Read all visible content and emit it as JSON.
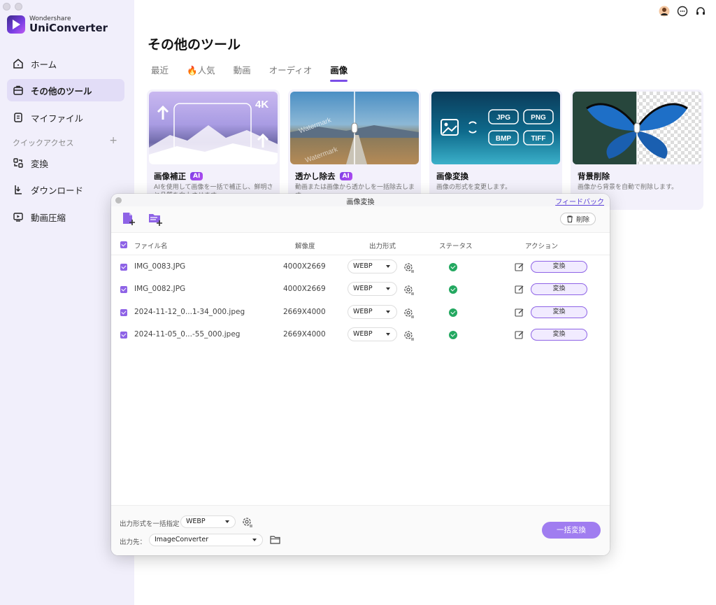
{
  "app": {
    "brand_small": "Wondershare",
    "brand_name": "UniConverter"
  },
  "sidebar": {
    "items": [
      {
        "label": "ホーム",
        "icon": "home-icon"
      },
      {
        "label": "その他のツール",
        "icon": "toolbox-icon",
        "active": true
      },
      {
        "label": "マイファイル",
        "icon": "file-icon"
      }
    ],
    "quick_access_label": "クイックアクセス",
    "quick_access_add": "+",
    "quick_items": [
      {
        "label": "変換",
        "icon": "convert-icon"
      },
      {
        "label": "ダウンロード",
        "icon": "download-icon"
      },
      {
        "label": "動画圧縮",
        "icon": "compress-icon"
      }
    ]
  },
  "header_icons": [
    "account-icon",
    "message-icon",
    "support-icon"
  ],
  "main": {
    "title": "その他のツール",
    "tabs": [
      {
        "label": "最近"
      },
      {
        "label": "🔥人気"
      },
      {
        "label": "動画"
      },
      {
        "label": "オーディオ"
      },
      {
        "label": "画像",
        "active": true
      }
    ],
    "cards": [
      {
        "title": "画像補正",
        "ai": "AI",
        "desc": "AIを使用して画像を一括で補正し、鮮明さと品質を向上させます。",
        "badge": "4K"
      },
      {
        "title": "透かし除去",
        "ai": "AI",
        "desc": "動画または画像から透かしを一括除去します。",
        "watermark": "Watermark"
      },
      {
        "title": "画像変換",
        "desc": "画像の形式を変更します。",
        "formats": [
          "JPG",
          "PNG",
          "BMP",
          "TIFF"
        ]
      },
      {
        "title": "背景削除",
        "desc": "画像から背景を自動で削除します。"
      }
    ]
  },
  "dialog": {
    "title": "画像変換",
    "feedback": "フィードバック",
    "delete_label": "削除",
    "columns": {
      "filename": "ファイル名",
      "resolution": "解像度",
      "format": "出力形式",
      "status": "ステータス",
      "action": "アクション"
    },
    "rows": [
      {
        "filename": "IMG_0083.JPG",
        "resolution": "4000X2669",
        "format": "WEBP",
        "action": "変換"
      },
      {
        "filename": "IMG_0082.JPG",
        "resolution": "4000X2669",
        "format": "WEBP",
        "action": "変換"
      },
      {
        "filename": "2024-11-12_0...1-34_000.jpeg",
        "resolution": "2669X4000",
        "format": "WEBP",
        "action": "変換"
      },
      {
        "filename": "2024-11-05_0...-55_000.jpeg",
        "resolution": "2669X4000",
        "format": "WEBP",
        "action": "変換"
      }
    ],
    "footer": {
      "batch_format_label": "出力形式を一括指定",
      "batch_format_value": "WEBP",
      "output_label": "出力先：",
      "output_value": "ImageConverter",
      "convert_all": "一括変換"
    }
  },
  "colors": {
    "sidebar_bg": "#f1effb",
    "accent": "#7b4fe8",
    "status_ok": "#23a860"
  }
}
